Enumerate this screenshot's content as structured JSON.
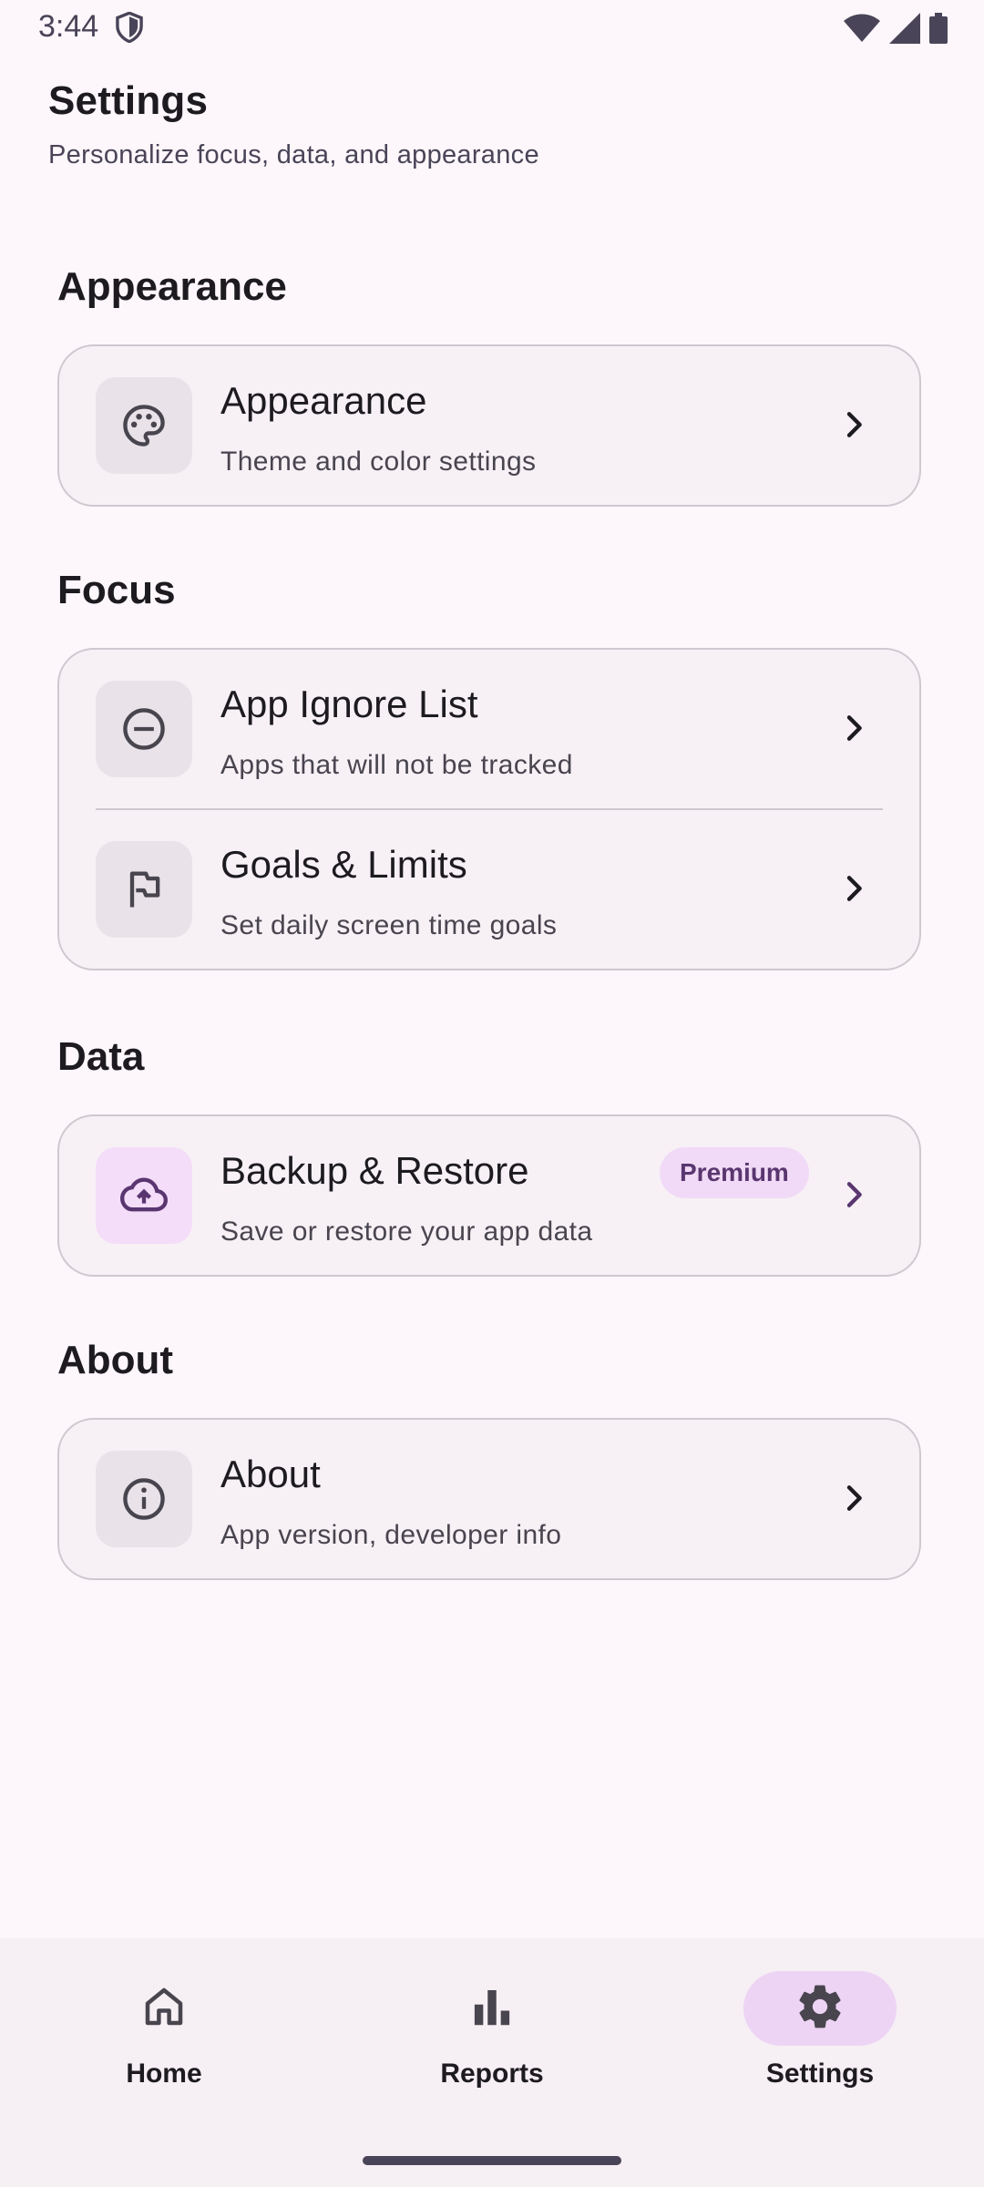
{
  "status_bar": {
    "time": "3:44"
  },
  "header": {
    "title": "Settings",
    "subtitle": "Personalize focus, data, and appearance"
  },
  "sections": {
    "appearance": {
      "title": "Appearance",
      "rows": [
        {
          "icon": "palette-icon",
          "title": "Appearance",
          "subtitle": "Theme and color settings"
        }
      ]
    },
    "focus": {
      "title": "Focus",
      "rows": [
        {
          "icon": "minus-circle-icon",
          "title": "App Ignore List",
          "subtitle": "Apps that will not be tracked"
        },
        {
          "icon": "flag-icon",
          "title": "Goals & Limits",
          "subtitle": "Set daily screen time goals"
        }
      ]
    },
    "data": {
      "title": "Data",
      "rows": [
        {
          "icon": "cloud-upload-icon",
          "title": "Backup & Restore",
          "subtitle": "Save or restore your app data",
          "badge": "Premium"
        }
      ]
    },
    "about": {
      "title": "About",
      "rows": [
        {
          "icon": "info-icon",
          "title": "About",
          "subtitle": "App version, developer info"
        }
      ]
    }
  },
  "nav": {
    "items": [
      {
        "label": "Home",
        "icon": "home-icon",
        "active": false
      },
      {
        "label": "Reports",
        "icon": "bar-chart-icon",
        "active": false
      },
      {
        "label": "Settings",
        "icon": "gear-icon",
        "active": true
      }
    ]
  },
  "colors": {
    "background": "#FDF7FB",
    "card": "#F7F1F6",
    "card_border": "#CFC8D0",
    "accent": "#EDD4F4",
    "premium_badge": "#F1DAF7",
    "premium_text": "#5A3670"
  }
}
